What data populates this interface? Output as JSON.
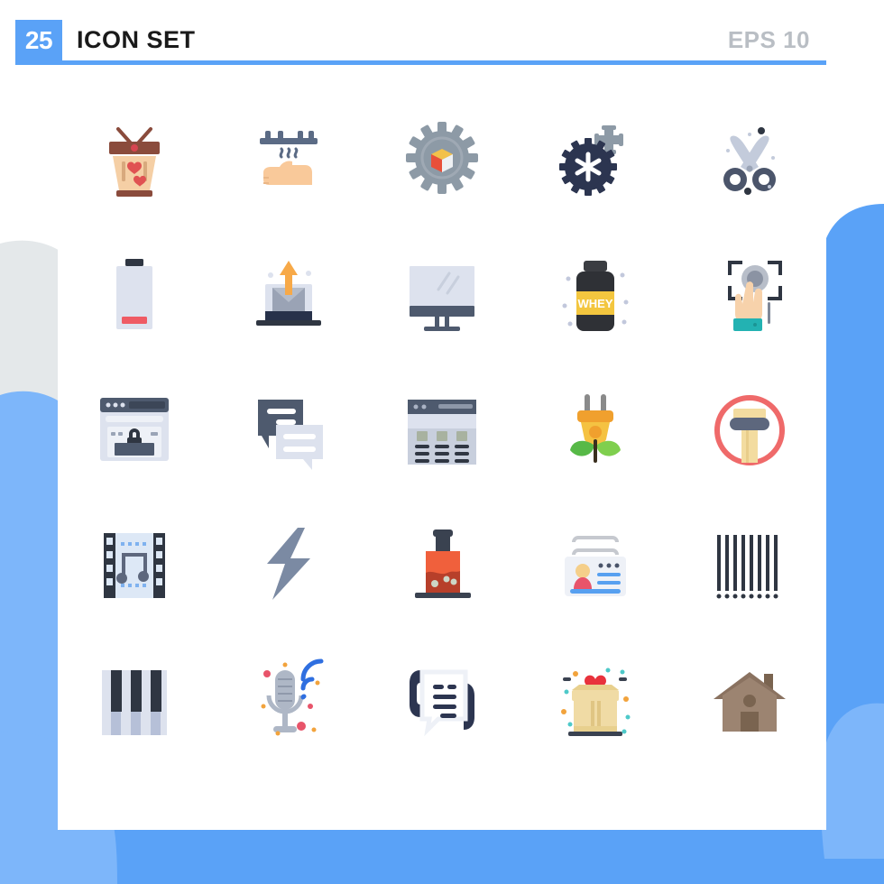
{
  "header": {
    "badge_count": "25",
    "title": "ICON SET",
    "format_label": "EPS 10",
    "accent_color": "#5aa2f7",
    "title_color": "#1a1a1a",
    "format_color": "#b9bec4"
  },
  "background": {
    "page_color": "#ffffff",
    "wave_blue": "#5aa2f7",
    "wave_blue_light": "#7db6fa",
    "wave_gray": "#e4e8ea",
    "card_color": "#ffffff"
  },
  "grid": {
    "columns": 5,
    "rows": 5,
    "total_icons": 25
  },
  "icons": [
    {
      "index": 1,
      "name": "shopping-basket-hearts-icon",
      "label": "Shopping Basket With Hearts",
      "row": 1,
      "col": 1,
      "colors": [
        "#8a4b3c",
        "#f5cfa5",
        "#e05252"
      ]
    },
    {
      "index": 2,
      "name": "hand-dryer-icon",
      "label": "Hand Dryer",
      "row": 1,
      "col": 2,
      "colors": [
        "#5b6b85",
        "#f9c99a"
      ]
    },
    {
      "index": 3,
      "name": "gear-package-icon",
      "label": "Gear With 3D Box",
      "row": 1,
      "col": 3,
      "colors": [
        "#8d9aa6",
        "#e8503a",
        "#f2c14a",
        "#eef1f4"
      ]
    },
    {
      "index": 4,
      "name": "machine-gear-wrench-icon",
      "label": "Machine Gear And Wrench",
      "row": 1,
      "col": 4,
      "colors": [
        "#2c3550",
        "#ffffff",
        "#8d9aa6"
      ]
    },
    {
      "index": 5,
      "name": "scissors-icon",
      "label": "Scissors",
      "row": 1,
      "col": 5,
      "colors": [
        "#4b556b",
        "#c3cbdb"
      ]
    },
    {
      "index": 6,
      "name": "low-battery-icon",
      "label": "Low Battery",
      "row": 2,
      "col": 1,
      "colors": [
        "#dde2ee",
        "#2f3642",
        "#ef5b64"
      ]
    },
    {
      "index": 7,
      "name": "send-email-laptop-icon",
      "label": "Send Email From Laptop",
      "row": 2,
      "col": 2,
      "colors": [
        "#dde2ee",
        "#9aa3b5",
        "#f7a948",
        "#27314a"
      ]
    },
    {
      "index": 8,
      "name": "computer-monitor-icon",
      "label": "Computer Monitor",
      "row": 2,
      "col": 3,
      "colors": [
        "#dde2ee",
        "#4e5a6e"
      ]
    },
    {
      "index": 9,
      "name": "whey-protein-bottle-icon",
      "label": "Whey Protein Supplement",
      "row": 2,
      "col": 4,
      "colors": [
        "#2f3136",
        "#f1c githubstub",
        "#f3c63f"
      ],
      "text": "WHEY"
    },
    {
      "index": 10,
      "name": "fingerprint-touch-hand-icon",
      "label": "Fingerprint Touch Scan",
      "row": 2,
      "col": 5,
      "colors": [
        "#2f3642",
        "#f7d2ab",
        "#23b2b2",
        "#b8bec9"
      ]
    },
    {
      "index": 11,
      "name": "secure-browser-lock-icon",
      "label": "Secure Browser With Lock",
      "row": 3,
      "col": 1,
      "colors": [
        "#dde2ee",
        "#4e5a6e",
        "#2f3642"
      ]
    },
    {
      "index": 12,
      "name": "chat-bubbles-icon",
      "label": "Chat Conversation Bubbles",
      "row": 3,
      "col": 2,
      "colors": [
        "#4e5a6e",
        "#dde2ee",
        "#ffffff"
      ]
    },
    {
      "index": 13,
      "name": "data-table-icon",
      "label": "Data Table Spreadsheet",
      "row": 3,
      "col": 3,
      "colors": [
        "#dde2ee",
        "#4e5a6e",
        "#a8b2a0"
      ]
    },
    {
      "index": 14,
      "name": "eco-plug-leaf-icon",
      "label": "Eco Energy Plug With Leaves",
      "row": 3,
      "col": 4,
      "colors": [
        "#f5c242",
        "#f0a02e",
        "#57b947",
        "#7fcf4e",
        "#8a8a8a"
      ]
    },
    {
      "index": 15,
      "name": "no-architecture-column-icon",
      "label": "Column In Prohibition Circle",
      "row": 3,
      "col": 5,
      "colors": [
        "#ef6a6a",
        "#f3dca0",
        "#5d677d"
      ]
    },
    {
      "index": 16,
      "name": "music-film-strip-icon",
      "label": "Music Film Strip",
      "row": 4,
      "col": 1,
      "colors": [
        "#2f3642",
        "#dde8f6",
        "#5d677d",
        "#7fb2ef"
      ]
    },
    {
      "index": 17,
      "name": "lightning-bolt-icon",
      "label": "Lightning Bolt",
      "row": 4,
      "col": 2,
      "colors": [
        "#7b8aa3"
      ]
    },
    {
      "index": 18,
      "name": "chemistry-flask-icon",
      "label": "Chemistry Flask",
      "row": 4,
      "col": 3,
      "colors": [
        "#f0603c",
        "#b73f2a",
        "#3a4250",
        "#cdd6c6"
      ]
    },
    {
      "index": 19,
      "name": "id-card-icon",
      "label": "Identification Card",
      "row": 4,
      "col": 4,
      "colors": [
        "#eef1f7",
        "#c6c9cf",
        "#f5cf8a",
        "#e8546a",
        "#57a0f0"
      ]
    },
    {
      "index": 20,
      "name": "barcode-icon",
      "label": "Barcode",
      "row": 4,
      "col": 5,
      "colors": [
        "#2f3642"
      ]
    },
    {
      "index": 21,
      "name": "piano-keys-icon",
      "label": "Piano Keys",
      "row": 5,
      "col": 1,
      "colors": [
        "#2f3642",
        "#dde2ee",
        "#b6c0d8"
      ]
    },
    {
      "index": 22,
      "name": "podcast-microphone-icon",
      "label": "Podcast Microphone",
      "row": 5,
      "col": 2,
      "colors": [
        "#aeb7c6",
        "#2f6fe0",
        "#e8546a",
        "#f2a33c"
      ]
    },
    {
      "index": 23,
      "name": "phone-support-chat-icon",
      "label": "Phone Support Chat",
      "row": 5,
      "col": 3,
      "colors": [
        "#2c3550",
        "#eef1f7"
      ]
    },
    {
      "index": 24,
      "name": "gift-box-hearts-icon",
      "label": "Gift Box With Hearts",
      "row": 5,
      "col": 4,
      "colors": [
        "#f0dba5",
        "#e8d08e",
        "#e8323c",
        "#3a4250",
        "#f2a33c",
        "#4ec9c9"
      ]
    },
    {
      "index": 25,
      "name": "house-home-icon",
      "label": "House Home",
      "row": 5,
      "col": 5,
      "colors": [
        "#9c8471",
        "#8a7260",
        "#7a6450"
      ]
    }
  ]
}
